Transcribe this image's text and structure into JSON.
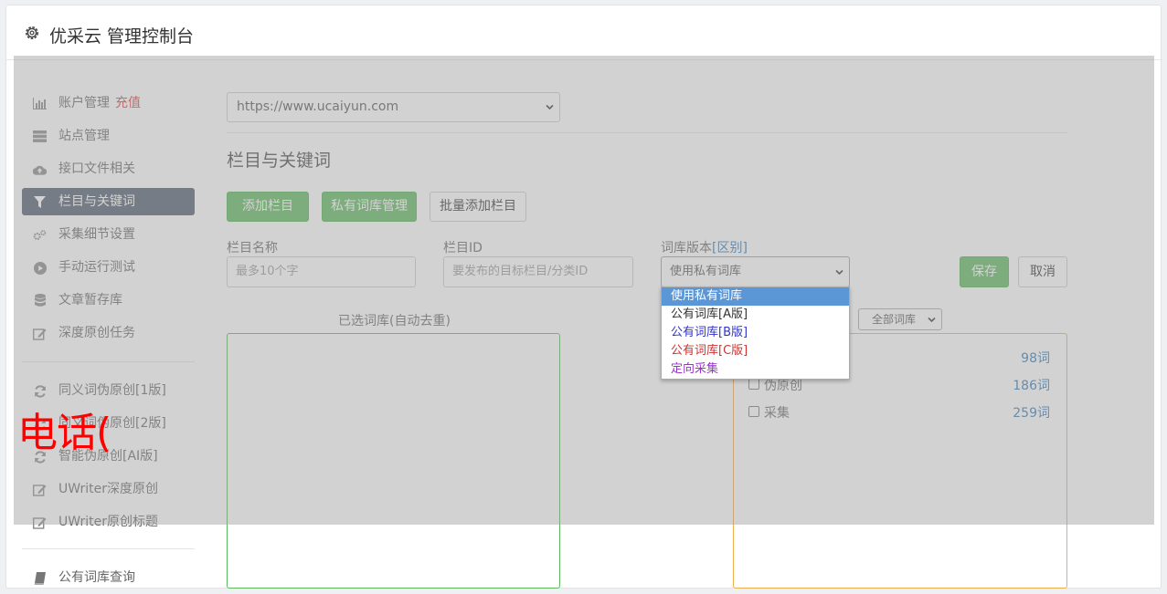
{
  "header": {
    "title": "优采云 管理控制台",
    "icon": "gear-icon"
  },
  "sidebar": {
    "group1": [
      {
        "label": "账户管理",
        "icon": "bar-chart-icon",
        "extra": "充值"
      },
      {
        "label": "站点管理",
        "icon": "server-icon"
      },
      {
        "label": "接口文件相关",
        "icon": "cloud-upload-icon"
      },
      {
        "label": "栏目与关键词",
        "icon": "filter-icon",
        "active": true
      },
      {
        "label": "采集细节设置",
        "icon": "cogs-icon"
      },
      {
        "label": "手动运行测试",
        "icon": "play-circle-icon"
      },
      {
        "label": "文章暂存库",
        "icon": "database-icon"
      },
      {
        "label": "深度原创任务",
        "icon": "edit-icon"
      }
    ],
    "group2": [
      {
        "label": "同义词伪原创[1版]",
        "icon": "refresh-icon"
      },
      {
        "label": "同义词伪原创[2版]",
        "icon": "refresh-icon"
      },
      {
        "label": "智能伪原创[AI版]",
        "icon": "refresh-icon"
      },
      {
        "label": "UWriter深度原创",
        "icon": "edit-icon"
      },
      {
        "label": "UWriter原创标题",
        "icon": "edit-icon"
      }
    ],
    "group3": [
      {
        "label": "公有词库查询",
        "icon": "book-icon"
      }
    ]
  },
  "main": {
    "site_select": "https://www.ucaiyun.com",
    "section_title": "栏目与关键词",
    "buttons": {
      "add_column": "添加栏目 +",
      "private_lexicon": "私有词库管理",
      "batch_add": "批量添加栏目",
      "save": "保存",
      "cancel": "取消"
    },
    "form": {
      "name_label": "栏目名称",
      "name_placeholder": "最多10个字",
      "id_label": "栏目ID",
      "id_placeholder": "要发布的目标栏目/分类ID",
      "version_label": "词库版本",
      "version_link": "[区别]",
      "version_value": "使用私有词库"
    },
    "selected_title": "已选词库(自动去重)",
    "filter_select": "全部词库",
    "lexicons": [
      {
        "name": "",
        "count": "98词"
      },
      {
        "name": "伪原创",
        "count": "186词"
      },
      {
        "name": "采集",
        "count": "259词"
      }
    ]
  },
  "dropdown": {
    "options": [
      {
        "label": "使用私有词库",
        "color": "#ffffff",
        "selected": true
      },
      {
        "label": "公有词库[A版]",
        "color": "#333333"
      },
      {
        "label": "公有词库[B版]",
        "color": "#3333cc"
      },
      {
        "label": "公有词库[C版]",
        "color": "#cc3333"
      },
      {
        "label": "定向采集",
        "color": "#9933cc"
      }
    ]
  },
  "watermark": "电话("
}
